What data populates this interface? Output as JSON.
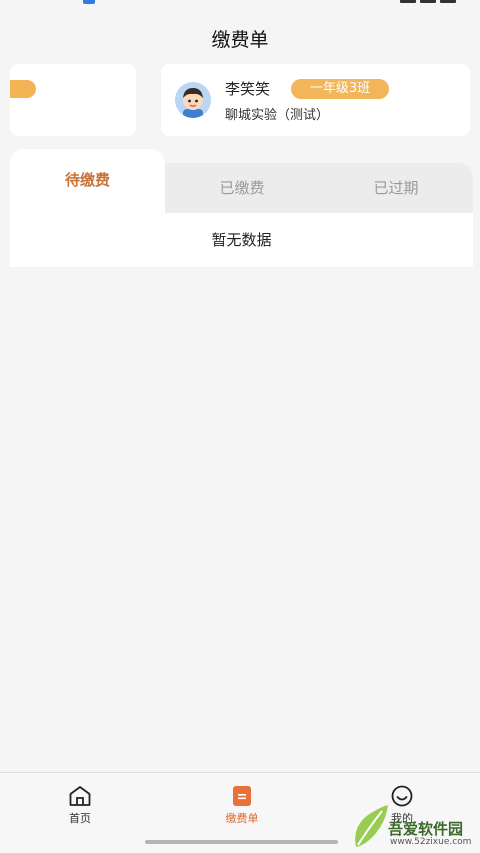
{
  "header": {
    "title": "缴费单"
  },
  "student": {
    "name": "李笑笑",
    "class": "一年级3班",
    "school": "聊城实验（测试）"
  },
  "tabs": [
    {
      "label": "待缴费",
      "active": true
    },
    {
      "label": "已缴费",
      "active": false
    },
    {
      "label": "已过期",
      "active": false
    }
  ],
  "empty_text": "暂无数据",
  "bottom_nav": [
    {
      "label": "首页",
      "icon": "home-icon",
      "active": false
    },
    {
      "label": "缴费单",
      "icon": "bill-icon",
      "active": true
    },
    {
      "label": "我的",
      "icon": "smile-icon",
      "active": false
    }
  ],
  "watermark": {
    "text": "吾爱软件园",
    "url": "www.52zixue.com"
  },
  "colors": {
    "accent": "#e06a2a",
    "badge": "#f3b55a",
    "active_tab_text": "#c8733a"
  }
}
